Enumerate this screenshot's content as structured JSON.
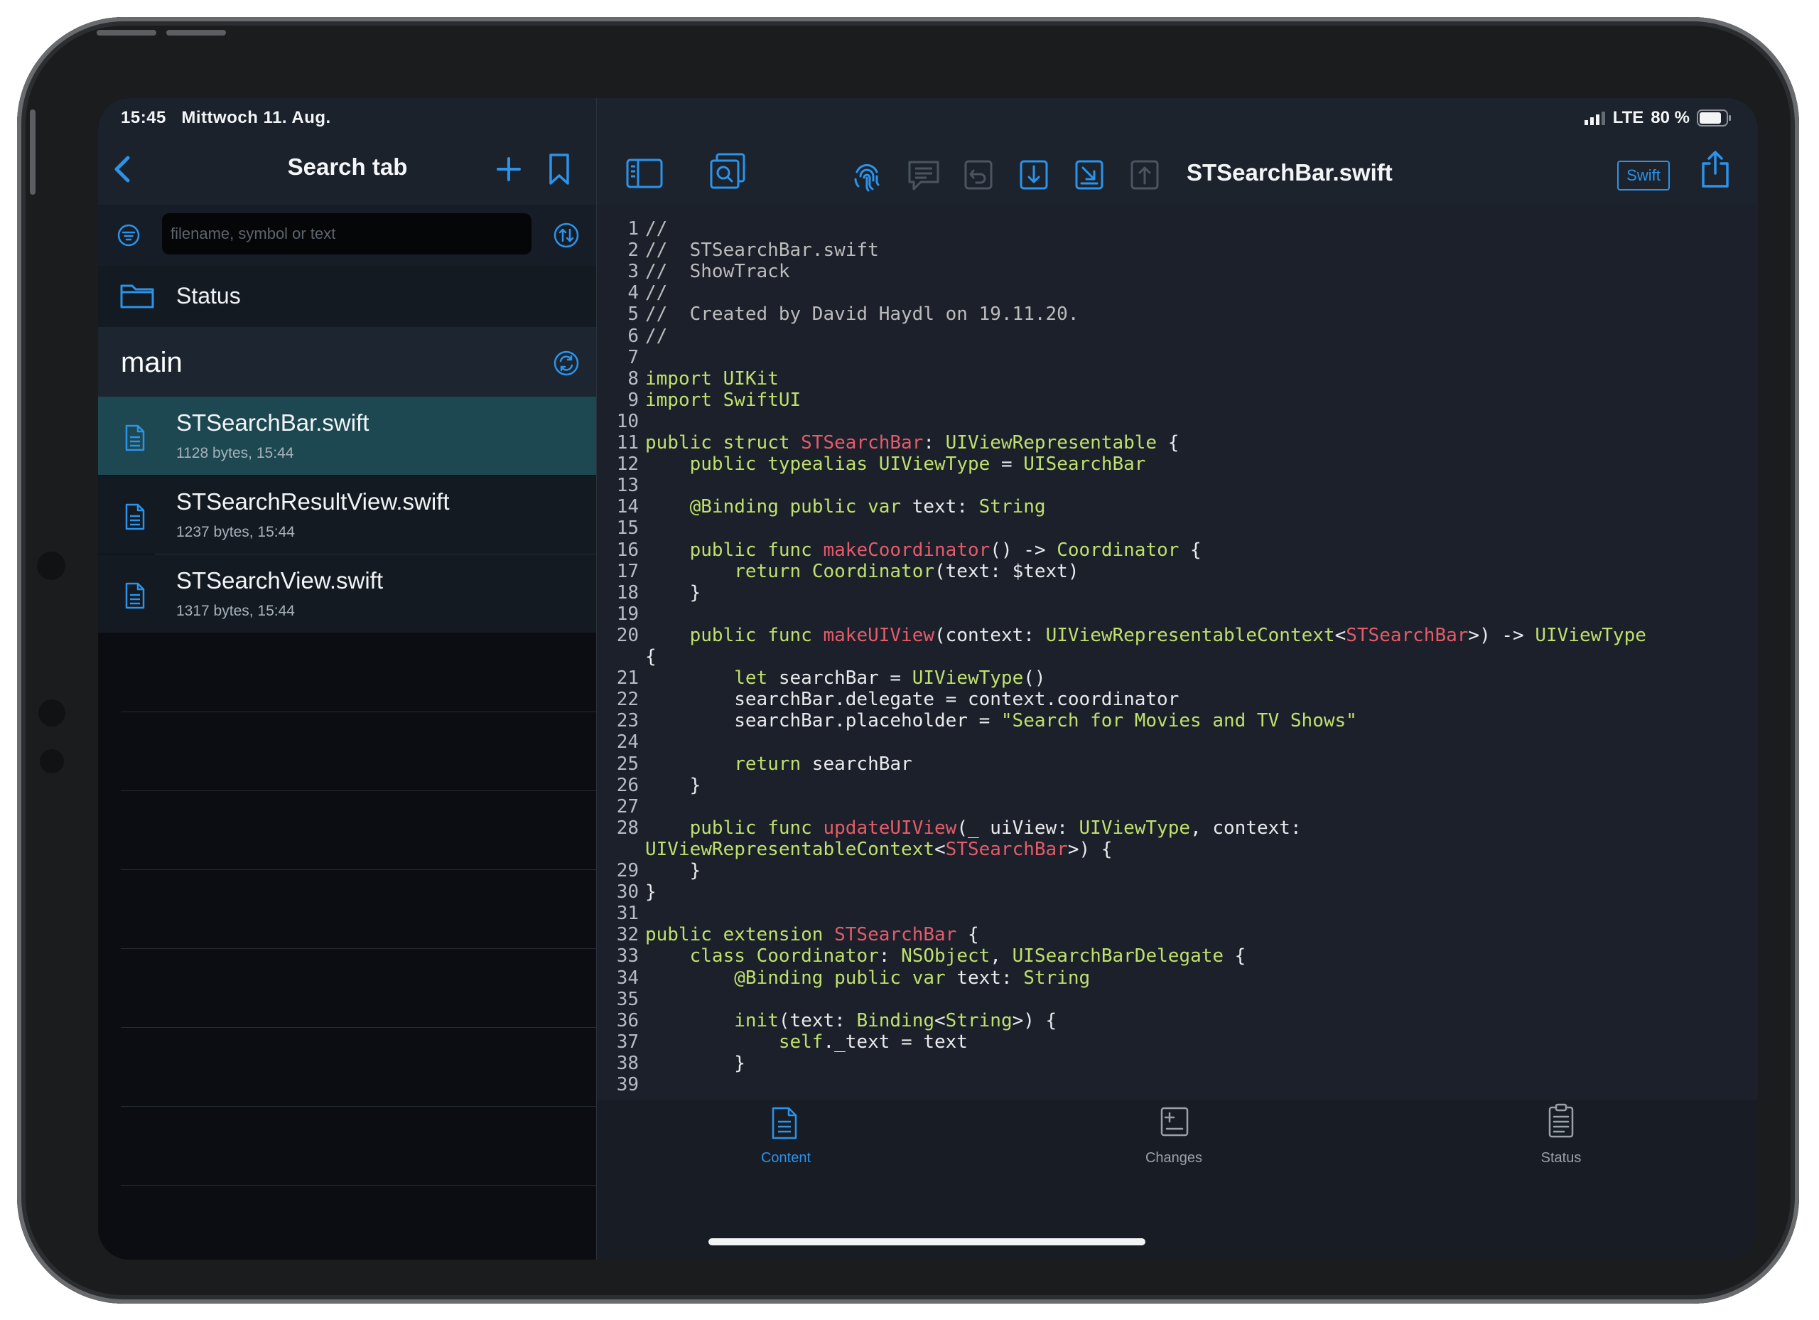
{
  "status_bar": {
    "time": "15:45",
    "date": "Mittwoch 11. Aug.",
    "network": "LTE",
    "battery": "80 %"
  },
  "sidebar": {
    "nav_title": "Search tab",
    "search": {
      "placeholder": "filename, symbol or text",
      "value": ""
    },
    "status_label": "Status",
    "branch": "main",
    "files": [
      {
        "name": "STSearchBar.swift",
        "meta": "1128 bytes, 15:44",
        "selected": true
      },
      {
        "name": "STSearchResultView.swift",
        "meta": "1237 bytes, 15:44",
        "selected": false
      },
      {
        "name": "STSearchView.swift",
        "meta": "1317 bytes, 15:44",
        "selected": false
      }
    ]
  },
  "editor": {
    "file_title": "STSearchBar.swift",
    "language_badge": "Swift",
    "lines": [
      {
        "n": "1",
        "text": "//"
      },
      {
        "n": "2",
        "text": "//  STSearchBar.swift"
      },
      {
        "n": "3",
        "text": "//  ShowTrack"
      },
      {
        "n": "4",
        "text": "//"
      },
      {
        "n": "5",
        "text": "//  Created by David Haydl on 19.11.20."
      },
      {
        "n": "6",
        "text": "//"
      },
      {
        "n": "7",
        "text": ""
      },
      {
        "n": "8",
        "text": "import UIKit"
      },
      {
        "n": "9",
        "text": "import SwiftUI"
      },
      {
        "n": "10",
        "text": ""
      },
      {
        "n": "11",
        "text": "public struct STSearchBar: UIViewRepresentable {"
      },
      {
        "n": "12",
        "text": "    public typealias UIViewType = UISearchBar"
      },
      {
        "n": "13",
        "text": ""
      },
      {
        "n": "14",
        "text": "    @Binding public var text: String"
      },
      {
        "n": "15",
        "text": ""
      },
      {
        "n": "16",
        "text": "    public func makeCoordinator() -> Coordinator {"
      },
      {
        "n": "17",
        "text": "        return Coordinator(text: $text)"
      },
      {
        "n": "18",
        "text": "    }"
      },
      {
        "n": "19",
        "text": ""
      },
      {
        "n": "20",
        "text": "    public func makeUIView(context: UIViewRepresentableContext<STSearchBar>) -> UIViewType"
      },
      {
        "n": "",
        "text": "{"
      },
      {
        "n": "21",
        "text": "        let searchBar = UIViewType()"
      },
      {
        "n": "22",
        "text": "        searchBar.delegate = context.coordinator"
      },
      {
        "n": "23",
        "text": "        searchBar.placeholder = \"Search for Movies and TV Shows\""
      },
      {
        "n": "24",
        "text": ""
      },
      {
        "n": "25",
        "text": "        return searchBar"
      },
      {
        "n": "26",
        "text": "    }"
      },
      {
        "n": "27",
        "text": ""
      },
      {
        "n": "28",
        "text": "    public func updateUIView(_ uiView: UIViewType, context:"
      },
      {
        "n": "",
        "text": "UIViewRepresentableContext<STSearchBar>) {"
      },
      {
        "n": "29",
        "text": "    }"
      },
      {
        "n": "30",
        "text": "}"
      },
      {
        "n": "31",
        "text": ""
      },
      {
        "n": "32",
        "text": "public extension STSearchBar {"
      },
      {
        "n": "33",
        "text": "    class Coordinator: NSObject, UISearchBarDelegate {"
      },
      {
        "n": "34",
        "text": "        @Binding public var text: String"
      },
      {
        "n": "35",
        "text": ""
      },
      {
        "n": "36",
        "text": "        init(text: Binding<String>) {"
      },
      {
        "n": "37",
        "text": "            self._text = text"
      },
      {
        "n": "38",
        "text": "        }"
      },
      {
        "n": "39",
        "text": ""
      }
    ]
  },
  "tabs": [
    {
      "label": "Content",
      "active": true
    },
    {
      "label": "Changes",
      "active": false
    },
    {
      "label": "Status",
      "active": false
    }
  ],
  "colors": {
    "accent": "#2c93ea",
    "keyword": "#bfe06c",
    "type_name": "#e45b6a",
    "comment": "#bcbcbc",
    "selected_row": "#1d4852"
  }
}
